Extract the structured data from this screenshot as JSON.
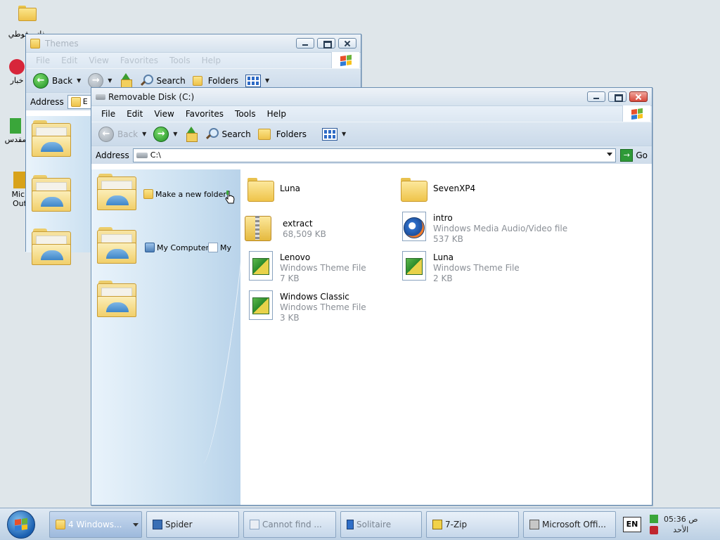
{
  "desktop": {
    "icons": [
      {
        "label": "ذاتي فوطي"
      },
      {
        "label": "خبار"
      },
      {
        "label": "مقدس"
      },
      {
        "label": "Micr Out"
      }
    ]
  },
  "back_window": {
    "title": "Themes",
    "menu": [
      "File",
      "Edit",
      "View",
      "Favorites",
      "Tools",
      "Help"
    ],
    "toolbar": {
      "back": "Back",
      "search": "Search",
      "folders": "Folders"
    },
    "address_label": "Address",
    "address_value": "E"
  },
  "front_window": {
    "title": "Removable Disk (C:)",
    "menu": [
      "File",
      "Edit",
      "View",
      "Favorites",
      "Tools",
      "Help"
    ],
    "toolbar": {
      "back": "Back",
      "search": "Search",
      "folders": "Folders"
    },
    "address_label": "Address",
    "address_value": "C:\\",
    "go_label": "Go",
    "tasks": {
      "make_folder": "Make a new folder",
      "my_computer": "My Computer",
      "my_docs": "My"
    },
    "files": [
      {
        "name": "Luna",
        "type": "",
        "size": "",
        "icon": "folder-icon"
      },
      {
        "name": "SevenXP4",
        "type": "",
        "size": "",
        "icon": "folder-icon"
      },
      {
        "name": "extract",
        "type": "",
        "size": "68,509 KB",
        "icon": "zip-icon"
      },
      {
        "name": "intro",
        "type": "Windows Media Audio/Video file",
        "size": "537 KB",
        "icon": "media-icon"
      },
      {
        "name": "Lenovo",
        "type": "Windows Theme File",
        "size": "7 KB",
        "icon": "theme-icon"
      },
      {
        "name": "Luna",
        "type": "Windows Theme File",
        "size": "2 KB",
        "icon": "theme-icon"
      },
      {
        "name": "Windows Classic",
        "type": "Windows Theme File",
        "size": "3 KB",
        "icon": "theme-icon"
      }
    ]
  },
  "taskbar": {
    "buttons": [
      {
        "label": "4 Windows..."
      },
      {
        "label": "Spider"
      },
      {
        "label": "Cannot find ..."
      },
      {
        "label": "Solitaire"
      },
      {
        "label": "7-Zip"
      },
      {
        "label": "Microsoft Offi..."
      }
    ],
    "language": "EN",
    "time": "05:36 ص",
    "day": "الأحد"
  }
}
